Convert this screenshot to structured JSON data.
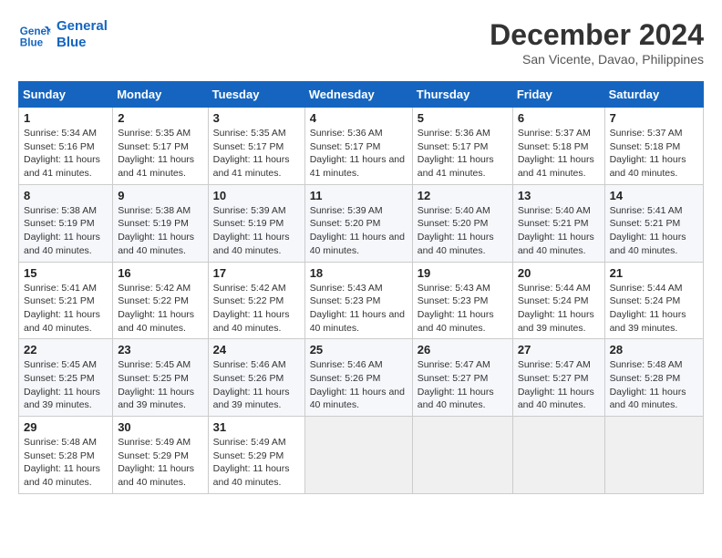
{
  "header": {
    "logo_line1": "General",
    "logo_line2": "Blue",
    "main_title": "December 2024",
    "subtitle": "San Vicente, Davao, Philippines"
  },
  "calendar": {
    "days_of_week": [
      "Sunday",
      "Monday",
      "Tuesday",
      "Wednesday",
      "Thursday",
      "Friday",
      "Saturday"
    ],
    "weeks": [
      [
        {
          "day": "",
          "info": ""
        },
        {
          "day": "2",
          "info": "Sunrise: 5:35 AM\nSunset: 5:17 PM\nDaylight: 11 hours and 41 minutes."
        },
        {
          "day": "3",
          "info": "Sunrise: 5:35 AM\nSunset: 5:17 PM\nDaylight: 11 hours and 41 minutes."
        },
        {
          "day": "4",
          "info": "Sunrise: 5:36 AM\nSunset: 5:17 PM\nDaylight: 11 hours and 41 minutes."
        },
        {
          "day": "5",
          "info": "Sunrise: 5:36 AM\nSunset: 5:17 PM\nDaylight: 11 hours and 41 minutes."
        },
        {
          "day": "6",
          "info": "Sunrise: 5:37 AM\nSunset: 5:18 PM\nDaylight: 11 hours and 41 minutes."
        },
        {
          "day": "7",
          "info": "Sunrise: 5:37 AM\nSunset: 5:18 PM\nDaylight: 11 hours and 40 minutes."
        }
      ],
      [
        {
          "day": "8",
          "info": "Sunrise: 5:38 AM\nSunset: 5:19 PM\nDaylight: 11 hours and 40 minutes."
        },
        {
          "day": "9",
          "info": "Sunrise: 5:38 AM\nSunset: 5:19 PM\nDaylight: 11 hours and 40 minutes."
        },
        {
          "day": "10",
          "info": "Sunrise: 5:39 AM\nSunset: 5:19 PM\nDaylight: 11 hours and 40 minutes."
        },
        {
          "day": "11",
          "info": "Sunrise: 5:39 AM\nSunset: 5:20 PM\nDaylight: 11 hours and 40 minutes."
        },
        {
          "day": "12",
          "info": "Sunrise: 5:40 AM\nSunset: 5:20 PM\nDaylight: 11 hours and 40 minutes."
        },
        {
          "day": "13",
          "info": "Sunrise: 5:40 AM\nSunset: 5:21 PM\nDaylight: 11 hours and 40 minutes."
        },
        {
          "day": "14",
          "info": "Sunrise: 5:41 AM\nSunset: 5:21 PM\nDaylight: 11 hours and 40 minutes."
        }
      ],
      [
        {
          "day": "15",
          "info": "Sunrise: 5:41 AM\nSunset: 5:21 PM\nDaylight: 11 hours and 40 minutes."
        },
        {
          "day": "16",
          "info": "Sunrise: 5:42 AM\nSunset: 5:22 PM\nDaylight: 11 hours and 40 minutes."
        },
        {
          "day": "17",
          "info": "Sunrise: 5:42 AM\nSunset: 5:22 PM\nDaylight: 11 hours and 40 minutes."
        },
        {
          "day": "18",
          "info": "Sunrise: 5:43 AM\nSunset: 5:23 PM\nDaylight: 11 hours and 40 minutes."
        },
        {
          "day": "19",
          "info": "Sunrise: 5:43 AM\nSunset: 5:23 PM\nDaylight: 11 hours and 40 minutes."
        },
        {
          "day": "20",
          "info": "Sunrise: 5:44 AM\nSunset: 5:24 PM\nDaylight: 11 hours and 39 minutes."
        },
        {
          "day": "21",
          "info": "Sunrise: 5:44 AM\nSunset: 5:24 PM\nDaylight: 11 hours and 39 minutes."
        }
      ],
      [
        {
          "day": "22",
          "info": "Sunrise: 5:45 AM\nSunset: 5:25 PM\nDaylight: 11 hours and 39 minutes."
        },
        {
          "day": "23",
          "info": "Sunrise: 5:45 AM\nSunset: 5:25 PM\nDaylight: 11 hours and 39 minutes."
        },
        {
          "day": "24",
          "info": "Sunrise: 5:46 AM\nSunset: 5:26 PM\nDaylight: 11 hours and 39 minutes."
        },
        {
          "day": "25",
          "info": "Sunrise: 5:46 AM\nSunset: 5:26 PM\nDaylight: 11 hours and 40 minutes."
        },
        {
          "day": "26",
          "info": "Sunrise: 5:47 AM\nSunset: 5:27 PM\nDaylight: 11 hours and 40 minutes."
        },
        {
          "day": "27",
          "info": "Sunrise: 5:47 AM\nSunset: 5:27 PM\nDaylight: 11 hours and 40 minutes."
        },
        {
          "day": "28",
          "info": "Sunrise: 5:48 AM\nSunset: 5:28 PM\nDaylight: 11 hours and 40 minutes."
        }
      ],
      [
        {
          "day": "29",
          "info": "Sunrise: 5:48 AM\nSunset: 5:28 PM\nDaylight: 11 hours and 40 minutes."
        },
        {
          "day": "30",
          "info": "Sunrise: 5:49 AM\nSunset: 5:29 PM\nDaylight: 11 hours and 40 minutes."
        },
        {
          "day": "31",
          "info": "Sunrise: 5:49 AM\nSunset: 5:29 PM\nDaylight: 11 hours and 40 minutes."
        },
        {
          "day": "",
          "info": ""
        },
        {
          "day": "",
          "info": ""
        },
        {
          "day": "",
          "info": ""
        },
        {
          "day": "",
          "info": ""
        }
      ]
    ],
    "week1_day1": {
      "day": "1",
      "info": "Sunrise: 5:34 AM\nSunset: 5:16 PM\nDaylight: 11 hours and 41 minutes."
    }
  }
}
